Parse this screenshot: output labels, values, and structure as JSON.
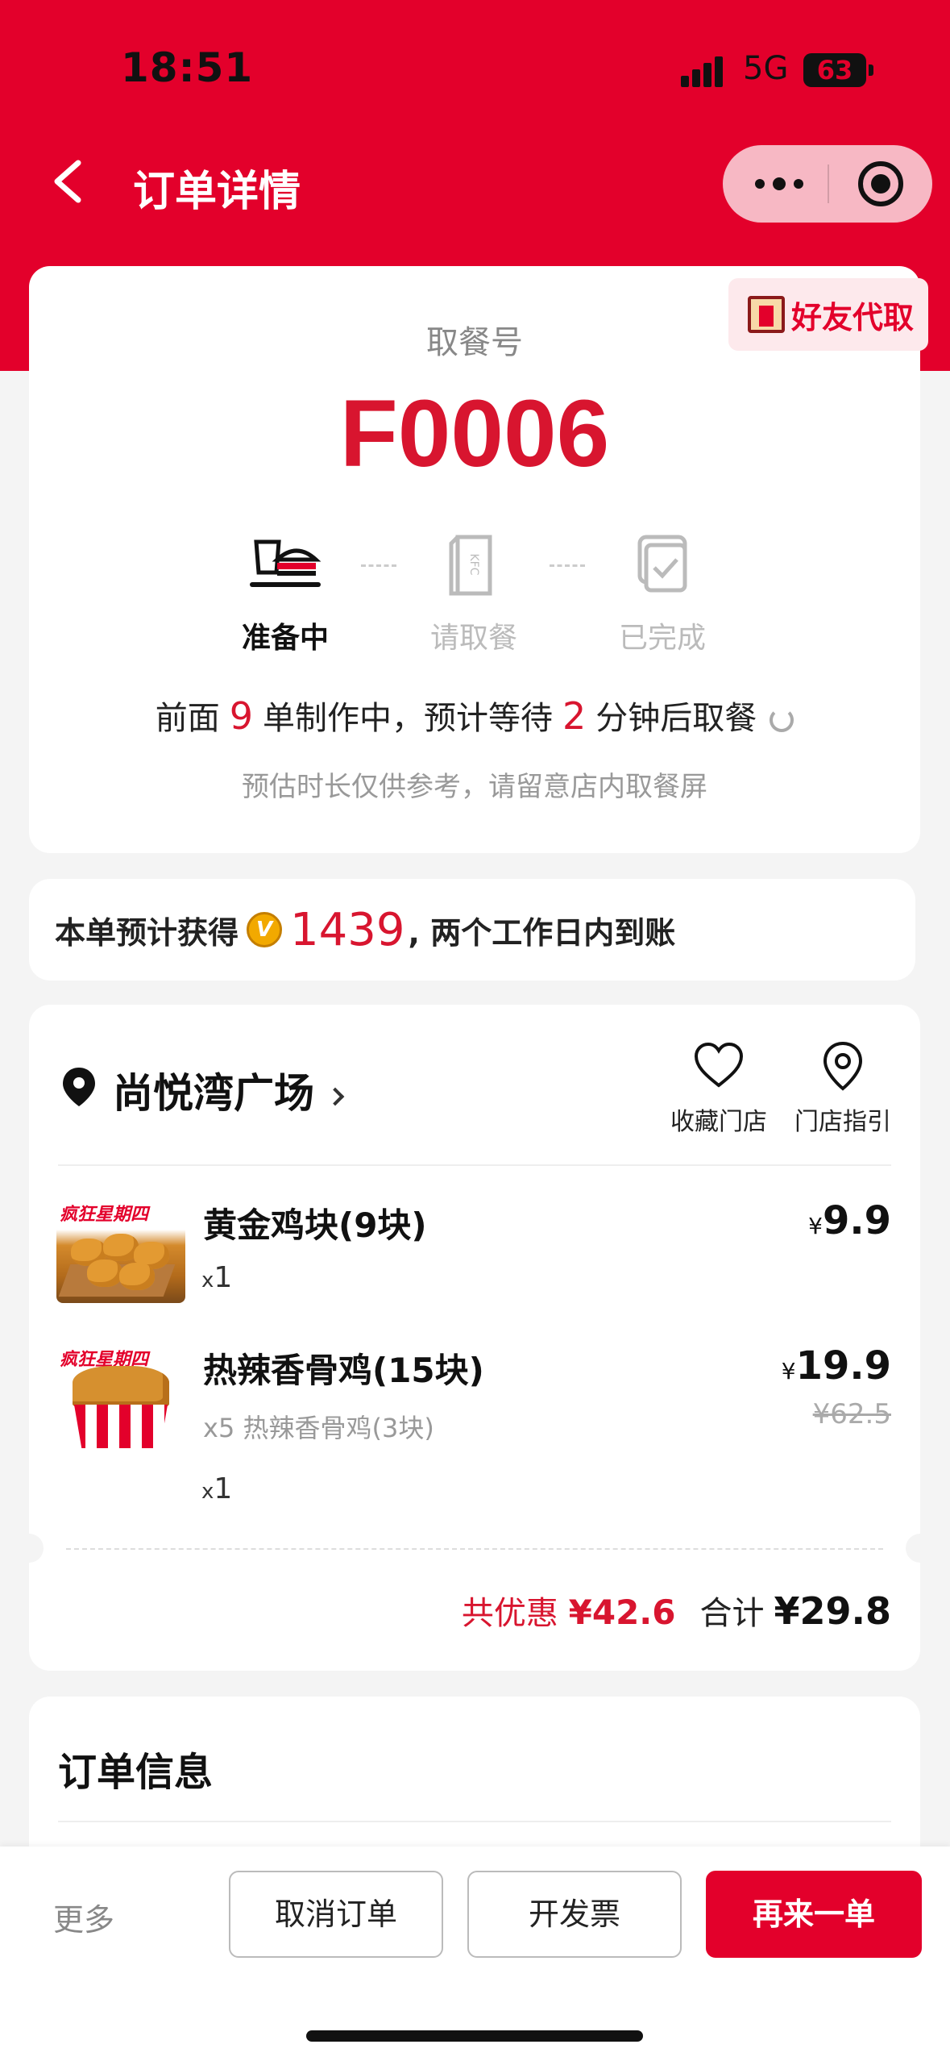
{
  "status_bar": {
    "time": "18:51",
    "network": "5G",
    "battery": "63"
  },
  "nav": {
    "title": "订单详情"
  },
  "pickup": {
    "friend_pickup_label": "好友代取",
    "label": "取餐号",
    "number": "F0006",
    "steps": [
      {
        "label": "准备中",
        "state": "active"
      },
      {
        "label": "请取餐",
        "state": "inactive"
      },
      {
        "label": "已完成",
        "state": "inactive"
      }
    ],
    "wait": {
      "prefix": "前面",
      "orders_ahead": "9",
      "middle": "单制作中，预计等待",
      "minutes": "2",
      "suffix": "分钟后取餐"
    },
    "note": "预估时长仅供参考，请留意店内取餐屏"
  },
  "points": {
    "prefix": "本单预计获得",
    "coin_icon": "V",
    "value": "1439",
    "suffix": ", 两个工作日内到账"
  },
  "store": {
    "name": "尚悦湾广场",
    "actions": {
      "favorite": "收藏门店",
      "directions": "门店指引"
    },
    "items": [
      {
        "tag": "疯狂星期四",
        "name": "黄金鸡块(9块)",
        "qty_prefix": "x",
        "qty": "1",
        "currency": "¥",
        "price": "9.9"
      },
      {
        "tag": "疯狂星期四",
        "name": "热辣香骨鸡(15块)",
        "desc": "x5 热辣香骨鸡(3块)",
        "qty_prefix": "x",
        "qty": "1",
        "currency": "¥",
        "price": "19.9",
        "original_price": "¥62.5"
      }
    ],
    "discount_label": "共优惠",
    "discount_value": "¥42.6",
    "total_label": "合计",
    "total_value": "¥29.8"
  },
  "order_info": {
    "title": "订单信息"
  },
  "bottom_bar": {
    "more": "更多",
    "cancel": "取消订单",
    "invoice": "开发票",
    "reorder": "再来一单"
  },
  "colors": {
    "brand_red": "#e3002b",
    "accent_red": "#d8152f",
    "background": "#f4f4f4"
  }
}
